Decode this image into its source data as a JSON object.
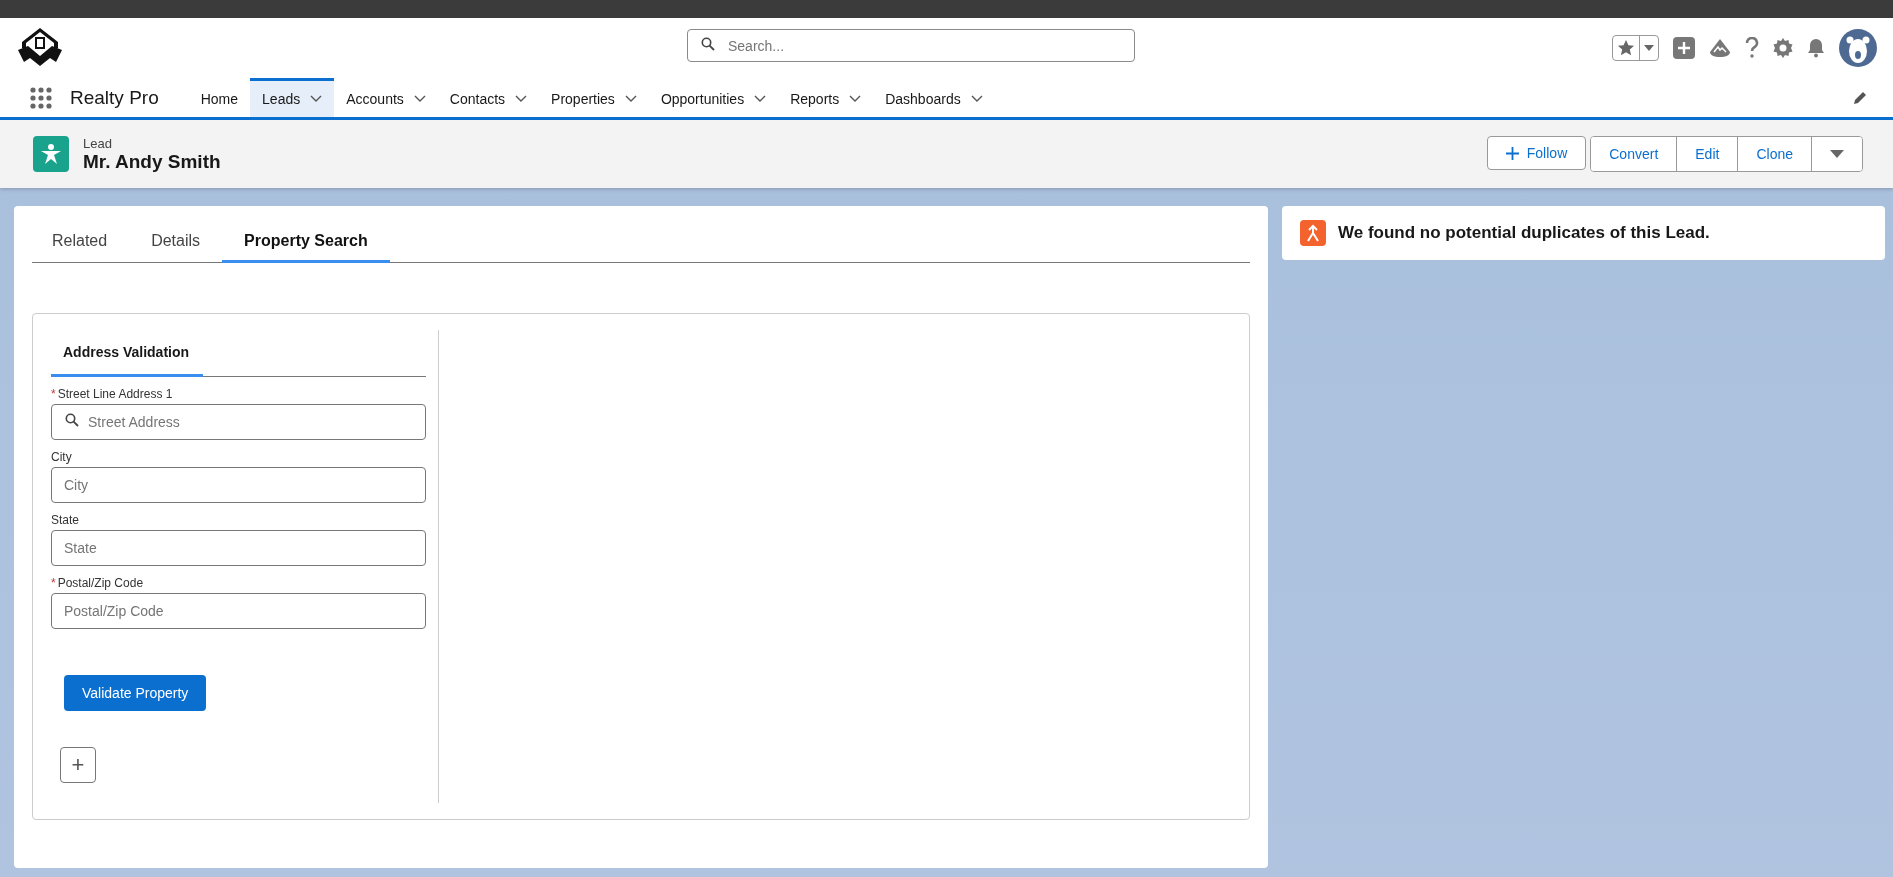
{
  "header": {
    "search": {
      "placeholder": "Search..."
    }
  },
  "nav": {
    "app_name": "Realty Pro",
    "items": [
      {
        "label": "Home",
        "selected": false,
        "has_menu": false
      },
      {
        "label": "Leads",
        "selected": true,
        "has_menu": true
      },
      {
        "label": "Accounts",
        "selected": false,
        "has_menu": true
      },
      {
        "label": "Contacts",
        "selected": false,
        "has_menu": true
      },
      {
        "label": "Properties",
        "selected": false,
        "has_menu": true
      },
      {
        "label": "Opportunities",
        "selected": false,
        "has_menu": true
      },
      {
        "label": "Reports",
        "selected": false,
        "has_menu": true
      },
      {
        "label": "Dashboards",
        "selected": false,
        "has_menu": true
      }
    ]
  },
  "record": {
    "type": "Lead",
    "name": "Mr. Andy Smith",
    "actions": [
      "Follow",
      "Convert",
      "Edit",
      "Clone"
    ]
  },
  "tabs": [
    {
      "label": "Related",
      "selected": false
    },
    {
      "label": "Details",
      "selected": false
    },
    {
      "label": "Property Search",
      "selected": true
    }
  ],
  "form": {
    "tabs": [
      {
        "label": "Address Validation",
        "selected": true
      }
    ],
    "fields": [
      {
        "label": "Street Line Address 1",
        "placeholder": "Street Address",
        "required_mark": "*",
        "kind": "search"
      },
      {
        "label": "City",
        "placeholder": "City",
        "kind": "text"
      },
      {
        "label": "State",
        "placeholder": "State",
        "kind": "text"
      },
      {
        "label": "Postal/Zip Code",
        "placeholder": "Postal/Zip Code",
        "required_mark": "*",
        "kind": "text"
      }
    ],
    "submit": "Validate Property",
    "add_symbol": "+"
  },
  "duplicates": {
    "message": "We found no potential duplicates of this Lead."
  }
}
